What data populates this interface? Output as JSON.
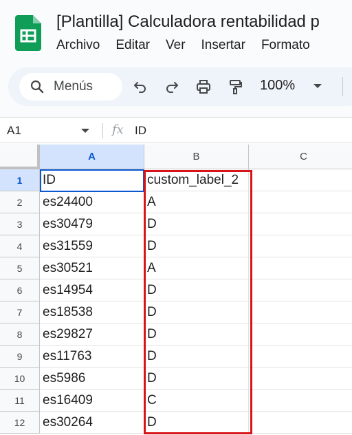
{
  "app": {
    "title": "[Plantilla] Calculadora rentabilidad p",
    "menu": [
      "Archivo",
      "Editar",
      "Ver",
      "Insertar",
      "Formato"
    ]
  },
  "toolbar": {
    "search_placeholder": "Menús",
    "icons": [
      "undo-icon",
      "redo-icon",
      "print-icon",
      "paint-format-icon"
    ],
    "zoom": "100%"
  },
  "formula_bar": {
    "cell_ref": "A1",
    "fx": "fx",
    "content": "ID"
  },
  "sheet": {
    "columns": [
      "A",
      "B",
      "C"
    ],
    "active_column": "A",
    "active_row": "1",
    "rows": [
      {
        "num": "1",
        "a": "ID",
        "b": "custom_label_2",
        "c": ""
      },
      {
        "num": "2",
        "a": "es24400",
        "b": "A",
        "c": ""
      },
      {
        "num": "3",
        "a": "es30479",
        "b": "D",
        "c": ""
      },
      {
        "num": "4",
        "a": "es31559",
        "b": "D",
        "c": ""
      },
      {
        "num": "5",
        "a": "es30521",
        "b": "A",
        "c": ""
      },
      {
        "num": "6",
        "a": "es14954",
        "b": "D",
        "c": ""
      },
      {
        "num": "7",
        "a": "es18538",
        "b": "D",
        "c": ""
      },
      {
        "num": "8",
        "a": "es29827",
        "b": "D",
        "c": ""
      },
      {
        "num": "9",
        "a": "es11763",
        "b": "D",
        "c": ""
      },
      {
        "num": "10",
        "a": "es5986",
        "b": "D",
        "c": ""
      },
      {
        "num": "11",
        "a": "es16409",
        "b": "C",
        "c": ""
      },
      {
        "num": "12",
        "a": "es30264",
        "b": "D",
        "c": ""
      }
    ]
  },
  "colors": {
    "accent": "#0b57d0",
    "highlight_box": "#d7141a",
    "sheets_green": "#0f9d58"
  }
}
